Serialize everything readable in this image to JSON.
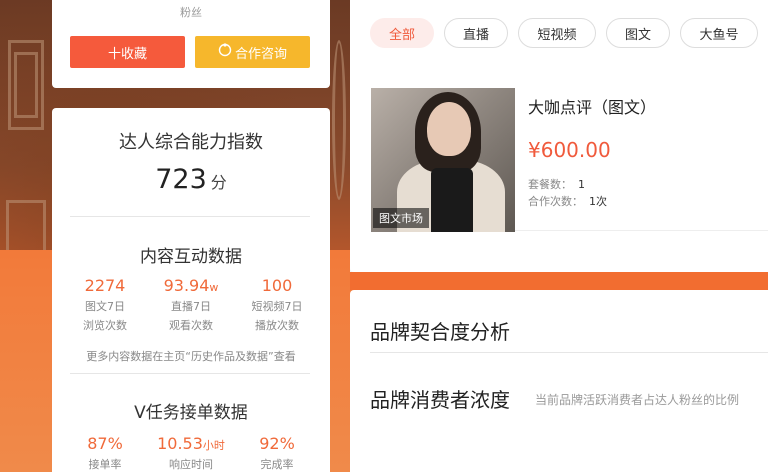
{
  "top_card": {
    "fans_label": "粉丝",
    "favorite_button": "十收藏",
    "consult_button": "合作咨询"
  },
  "stats": {
    "ability_title": "达人综合能力指数",
    "score": "723",
    "score_unit": "分",
    "interaction_title": "内容互动数据",
    "interaction_metrics": [
      {
        "value": "2274",
        "unit": "",
        "label1": "图文7日",
        "label2": "浏览次数"
      },
      {
        "value": "93.94",
        "unit": "w",
        "label1": "直播7日",
        "label2": "观看次数"
      },
      {
        "value": "100",
        "unit": "",
        "label1": "短视频7日",
        "label2": "播放次数"
      }
    ],
    "interaction_note": "更多内容数据在主页“历史作品及数据”查看",
    "task_title": "V任务接单数据",
    "task_metrics": [
      {
        "value": "87%",
        "unit": "",
        "label1": "接单率"
      },
      {
        "value": "10.53",
        "unit": "小时",
        "label1": "响应时间"
      },
      {
        "value": "92%",
        "unit": "",
        "label1": "完成率"
      }
    ]
  },
  "filters": {
    "tabs": [
      "全部",
      "直播",
      "短视频",
      "图文",
      "大鱼号"
    ],
    "active_index": 0
  },
  "product": {
    "image_tag": "图文市场",
    "title": "大咖点评（图文）",
    "price": "¥600.00",
    "package_label": "套餐数：",
    "package_value": "1",
    "coop_label": "合作次数：",
    "coop_value": "1次"
  },
  "brand": {
    "fit_title": "品牌契合度分析",
    "consumer_title": "品牌消费者浓度",
    "consumer_desc": "当前品牌活跃消费者占达人粉丝的比例"
  },
  "colors": {
    "accent": "#f05a3c",
    "coop_button": "#f6b72c",
    "background_orange": "#f06a2e"
  }
}
